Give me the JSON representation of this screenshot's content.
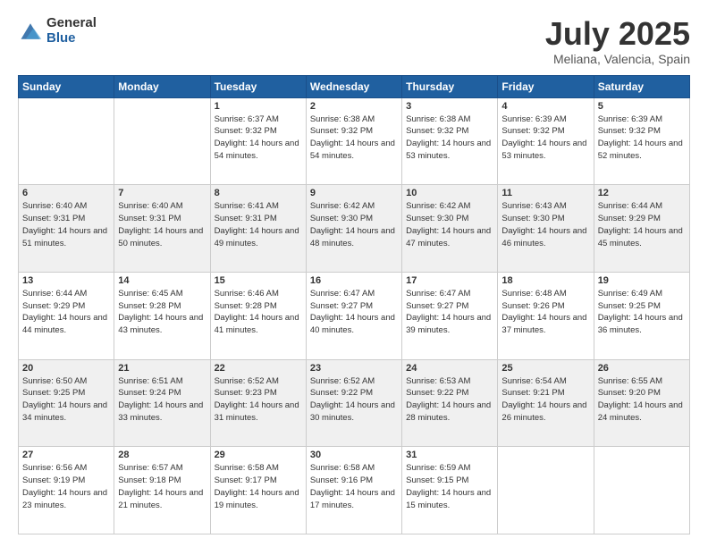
{
  "header": {
    "logo_general": "General",
    "logo_blue": "Blue",
    "month_title": "July 2025",
    "location": "Meliana, Valencia, Spain"
  },
  "days_of_week": [
    "Sunday",
    "Monday",
    "Tuesday",
    "Wednesday",
    "Thursday",
    "Friday",
    "Saturday"
  ],
  "weeks": [
    [
      {
        "day": "",
        "sunrise": "",
        "sunset": "",
        "daylight": "",
        "empty": true
      },
      {
        "day": "",
        "sunrise": "",
        "sunset": "",
        "daylight": "",
        "empty": true
      },
      {
        "day": "1",
        "sunrise": "Sunrise: 6:37 AM",
        "sunset": "Sunset: 9:32 PM",
        "daylight": "Daylight: 14 hours and 54 minutes.",
        "empty": false
      },
      {
        "day": "2",
        "sunrise": "Sunrise: 6:38 AM",
        "sunset": "Sunset: 9:32 PM",
        "daylight": "Daylight: 14 hours and 54 minutes.",
        "empty": false
      },
      {
        "day": "3",
        "sunrise": "Sunrise: 6:38 AM",
        "sunset": "Sunset: 9:32 PM",
        "daylight": "Daylight: 14 hours and 53 minutes.",
        "empty": false
      },
      {
        "day": "4",
        "sunrise": "Sunrise: 6:39 AM",
        "sunset": "Sunset: 9:32 PM",
        "daylight": "Daylight: 14 hours and 53 minutes.",
        "empty": false
      },
      {
        "day": "5",
        "sunrise": "Sunrise: 6:39 AM",
        "sunset": "Sunset: 9:32 PM",
        "daylight": "Daylight: 14 hours and 52 minutes.",
        "empty": false
      }
    ],
    [
      {
        "day": "6",
        "sunrise": "Sunrise: 6:40 AM",
        "sunset": "Sunset: 9:31 PM",
        "daylight": "Daylight: 14 hours and 51 minutes.",
        "empty": false
      },
      {
        "day": "7",
        "sunrise": "Sunrise: 6:40 AM",
        "sunset": "Sunset: 9:31 PM",
        "daylight": "Daylight: 14 hours and 50 minutes.",
        "empty": false
      },
      {
        "day": "8",
        "sunrise": "Sunrise: 6:41 AM",
        "sunset": "Sunset: 9:31 PM",
        "daylight": "Daylight: 14 hours and 49 minutes.",
        "empty": false
      },
      {
        "day": "9",
        "sunrise": "Sunrise: 6:42 AM",
        "sunset": "Sunset: 9:30 PM",
        "daylight": "Daylight: 14 hours and 48 minutes.",
        "empty": false
      },
      {
        "day": "10",
        "sunrise": "Sunrise: 6:42 AM",
        "sunset": "Sunset: 9:30 PM",
        "daylight": "Daylight: 14 hours and 47 minutes.",
        "empty": false
      },
      {
        "day": "11",
        "sunrise": "Sunrise: 6:43 AM",
        "sunset": "Sunset: 9:30 PM",
        "daylight": "Daylight: 14 hours and 46 minutes.",
        "empty": false
      },
      {
        "day": "12",
        "sunrise": "Sunrise: 6:44 AM",
        "sunset": "Sunset: 9:29 PM",
        "daylight": "Daylight: 14 hours and 45 minutes.",
        "empty": false
      }
    ],
    [
      {
        "day": "13",
        "sunrise": "Sunrise: 6:44 AM",
        "sunset": "Sunset: 9:29 PM",
        "daylight": "Daylight: 14 hours and 44 minutes.",
        "empty": false
      },
      {
        "day": "14",
        "sunrise": "Sunrise: 6:45 AM",
        "sunset": "Sunset: 9:28 PM",
        "daylight": "Daylight: 14 hours and 43 minutes.",
        "empty": false
      },
      {
        "day": "15",
        "sunrise": "Sunrise: 6:46 AM",
        "sunset": "Sunset: 9:28 PM",
        "daylight": "Daylight: 14 hours and 41 minutes.",
        "empty": false
      },
      {
        "day": "16",
        "sunrise": "Sunrise: 6:47 AM",
        "sunset": "Sunset: 9:27 PM",
        "daylight": "Daylight: 14 hours and 40 minutes.",
        "empty": false
      },
      {
        "day": "17",
        "sunrise": "Sunrise: 6:47 AM",
        "sunset": "Sunset: 9:27 PM",
        "daylight": "Daylight: 14 hours and 39 minutes.",
        "empty": false
      },
      {
        "day": "18",
        "sunrise": "Sunrise: 6:48 AM",
        "sunset": "Sunset: 9:26 PM",
        "daylight": "Daylight: 14 hours and 37 minutes.",
        "empty": false
      },
      {
        "day": "19",
        "sunrise": "Sunrise: 6:49 AM",
        "sunset": "Sunset: 9:25 PM",
        "daylight": "Daylight: 14 hours and 36 minutes.",
        "empty": false
      }
    ],
    [
      {
        "day": "20",
        "sunrise": "Sunrise: 6:50 AM",
        "sunset": "Sunset: 9:25 PM",
        "daylight": "Daylight: 14 hours and 34 minutes.",
        "empty": false
      },
      {
        "day": "21",
        "sunrise": "Sunrise: 6:51 AM",
        "sunset": "Sunset: 9:24 PM",
        "daylight": "Daylight: 14 hours and 33 minutes.",
        "empty": false
      },
      {
        "day": "22",
        "sunrise": "Sunrise: 6:52 AM",
        "sunset": "Sunset: 9:23 PM",
        "daylight": "Daylight: 14 hours and 31 minutes.",
        "empty": false
      },
      {
        "day": "23",
        "sunrise": "Sunrise: 6:52 AM",
        "sunset": "Sunset: 9:22 PM",
        "daylight": "Daylight: 14 hours and 30 minutes.",
        "empty": false
      },
      {
        "day": "24",
        "sunrise": "Sunrise: 6:53 AM",
        "sunset": "Sunset: 9:22 PM",
        "daylight": "Daylight: 14 hours and 28 minutes.",
        "empty": false
      },
      {
        "day": "25",
        "sunrise": "Sunrise: 6:54 AM",
        "sunset": "Sunset: 9:21 PM",
        "daylight": "Daylight: 14 hours and 26 minutes.",
        "empty": false
      },
      {
        "day": "26",
        "sunrise": "Sunrise: 6:55 AM",
        "sunset": "Sunset: 9:20 PM",
        "daylight": "Daylight: 14 hours and 24 minutes.",
        "empty": false
      }
    ],
    [
      {
        "day": "27",
        "sunrise": "Sunrise: 6:56 AM",
        "sunset": "Sunset: 9:19 PM",
        "daylight": "Daylight: 14 hours and 23 minutes.",
        "empty": false
      },
      {
        "day": "28",
        "sunrise": "Sunrise: 6:57 AM",
        "sunset": "Sunset: 9:18 PM",
        "daylight": "Daylight: 14 hours and 21 minutes.",
        "empty": false
      },
      {
        "day": "29",
        "sunrise": "Sunrise: 6:58 AM",
        "sunset": "Sunset: 9:17 PM",
        "daylight": "Daylight: 14 hours and 19 minutes.",
        "empty": false
      },
      {
        "day": "30",
        "sunrise": "Sunrise: 6:58 AM",
        "sunset": "Sunset: 9:16 PM",
        "daylight": "Daylight: 14 hours and 17 minutes.",
        "empty": false
      },
      {
        "day": "31",
        "sunrise": "Sunrise: 6:59 AM",
        "sunset": "Sunset: 9:15 PM",
        "daylight": "Daylight: 14 hours and 15 minutes.",
        "empty": false
      },
      {
        "day": "",
        "sunrise": "",
        "sunset": "",
        "daylight": "",
        "empty": true
      },
      {
        "day": "",
        "sunrise": "",
        "sunset": "",
        "daylight": "",
        "empty": true
      }
    ]
  ]
}
